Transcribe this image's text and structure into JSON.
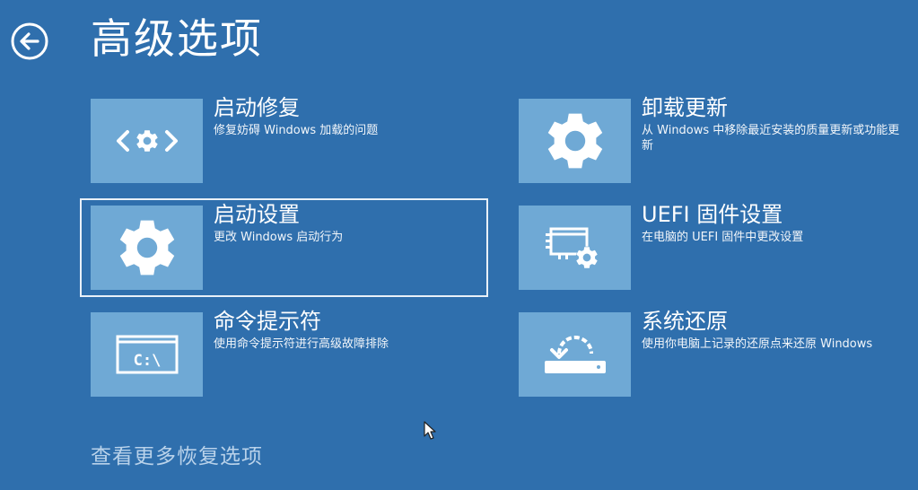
{
  "page": {
    "title": "高级选项",
    "more_link": "查看更多恢复选项"
  },
  "options": [
    {
      "title": "启动修复",
      "description": "修复妨碍 Windows 加载的问题",
      "icon": "startup-repair-icon"
    },
    {
      "title": "卸载更新",
      "description": "从 Windows 中移除最近安装的质量更新或功能更新",
      "icon": "gear-icon"
    },
    {
      "title": "启动设置",
      "description": "更改 Windows 启动行为",
      "icon": "gear-icon",
      "selected": true
    },
    {
      "title": "UEFI 固件设置",
      "description": "在电脑的 UEFI 固件中更改设置",
      "icon": "firmware-settings-icon"
    },
    {
      "title": "命令提示符",
      "description": "使用命令提示符进行高级故障排除",
      "icon": "command-prompt-icon",
      "glyph": "C:\\"
    },
    {
      "title": "系统还原",
      "description": "使用你电脑上记录的还原点来还原 Windows",
      "icon": "system-restore-icon"
    }
  ],
  "colors": {
    "background": "#2f6fad",
    "tile": "#6fa9d5",
    "text": "#ffffff",
    "link": "#b9d2ea"
  }
}
